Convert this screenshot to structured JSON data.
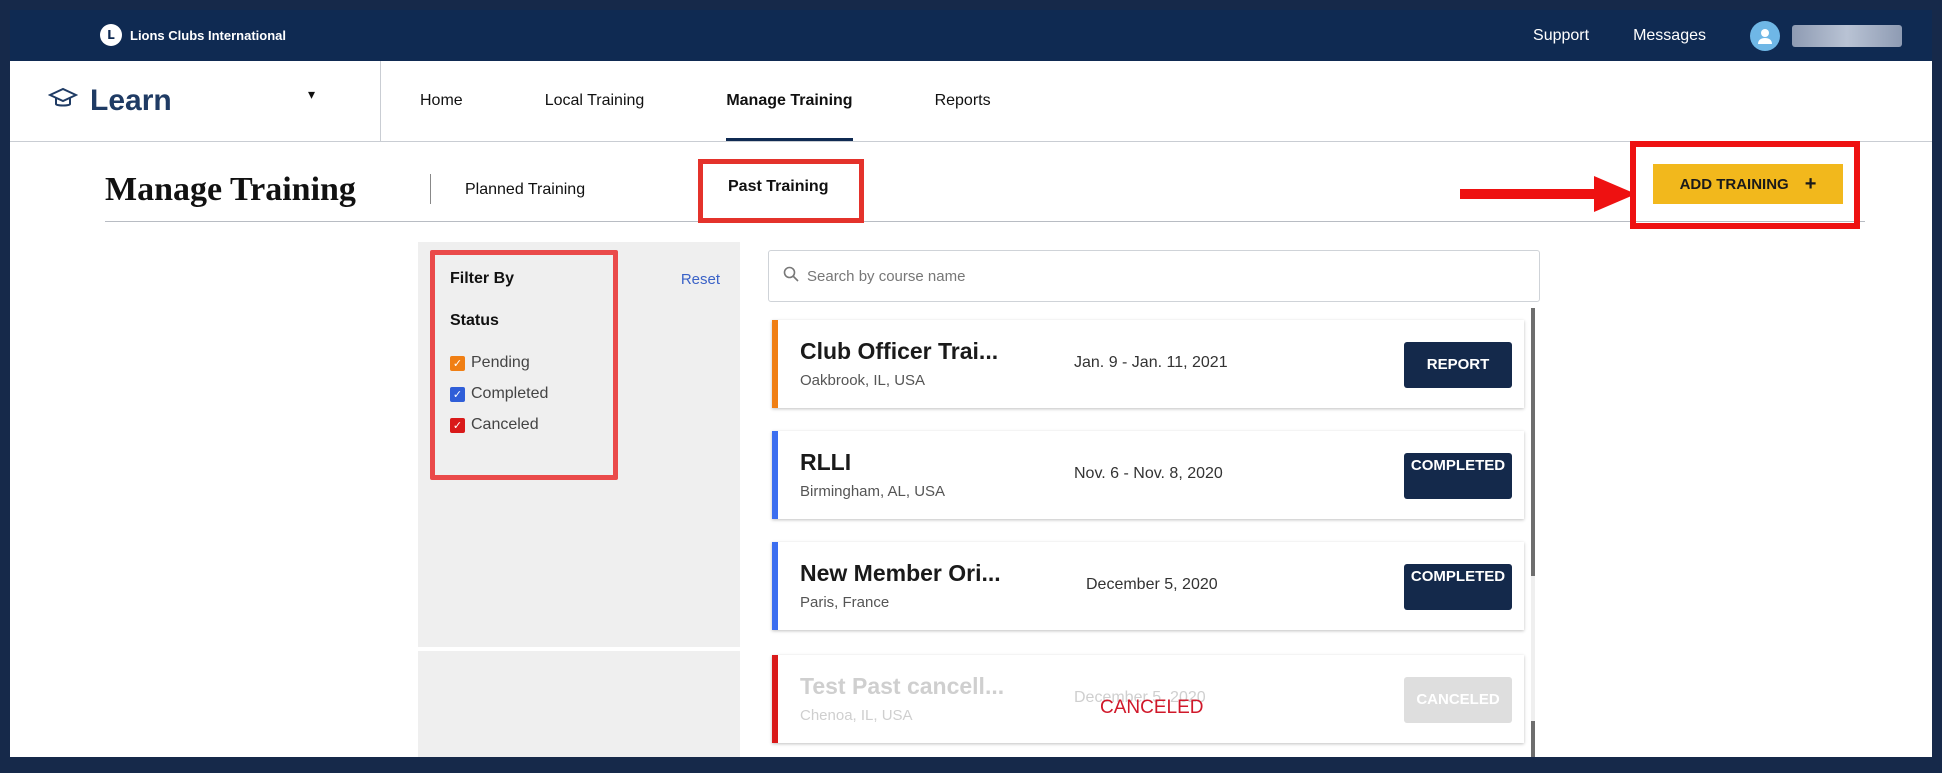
{
  "topbar": {
    "brand_logo": "L",
    "brand": "Lions Clubs International",
    "links": [
      "Support",
      "Messages"
    ],
    "avatar_icon": "user-avatar-icon"
  },
  "nav": {
    "app_title": "Learn",
    "caret": "▾",
    "items": [
      "Home",
      "Local Training",
      "Manage Training",
      "Reports"
    ],
    "active": "Manage Training"
  },
  "subheader": {
    "title": "Manage Training",
    "tabs": [
      "Planned Training",
      "Past Training"
    ],
    "active_tab": "Past Training",
    "add_button": "ADD TRAINING",
    "add_plus": "+"
  },
  "filter": {
    "heading": "Filter By",
    "reset": "Reset",
    "status_label": "Status",
    "options": [
      {
        "label": "Pending",
        "checked": true,
        "color": "#f07f14"
      },
      {
        "label": "Completed",
        "checked": true,
        "color": "#2f5ed8"
      },
      {
        "label": "Canceled",
        "checked": true,
        "color": "#d91a1a"
      }
    ]
  },
  "search": {
    "placeholder": "Search by course name"
  },
  "trainings": [
    {
      "title": "Club Officer Trai...",
      "location": "Oakbrook, IL, USA",
      "date": "Jan. 9 - Jan. 11, 2021",
      "action": "REPORT",
      "status_color": "#f07f14"
    },
    {
      "title": "RLLI",
      "location": "Birmingham, AL, USA",
      "date": "Nov. 6 - Nov. 8, 2020",
      "action": "COMPLETED",
      "status_color": "#3b6ef0"
    },
    {
      "title": "New Member Ori...",
      "location": "Paris, France",
      "date": "December 5, 2020",
      "action": "COMPLETED",
      "status_color": "#3b6ef0"
    },
    {
      "title": "Test Past cancell...",
      "location": "Chenoa, IL, USA",
      "date": "December 5, 2020",
      "action": "CANCELED",
      "status_color": "#d91a1a",
      "overlay": "CANCELED"
    }
  ]
}
